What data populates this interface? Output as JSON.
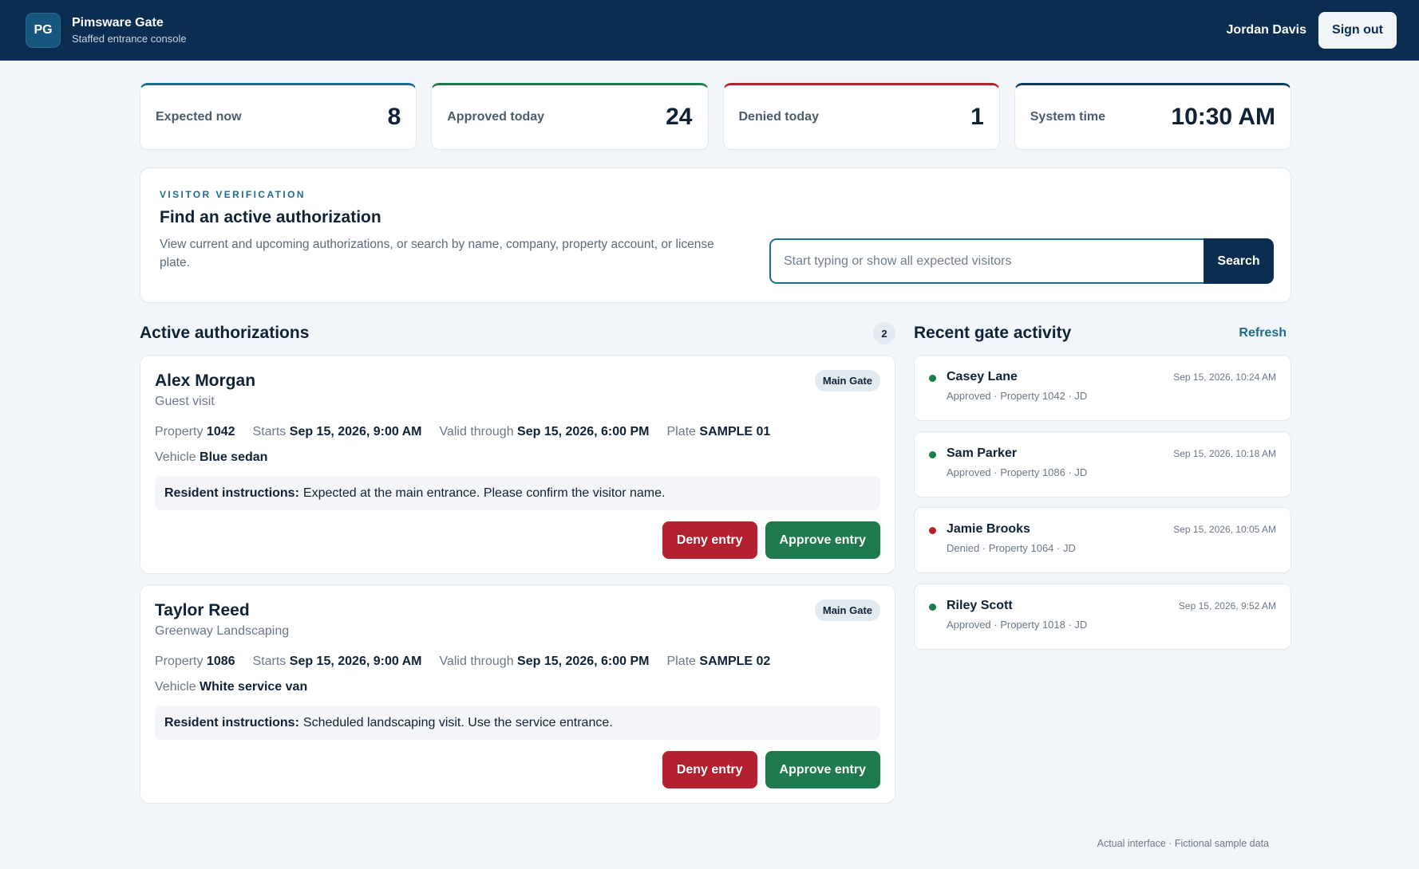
{
  "header": {
    "logo_text": "PG",
    "app_title": "Pimsware Gate",
    "app_subtitle": "Staffed entrance console",
    "user_name": "Jordan Davis",
    "signout_label": "Sign out"
  },
  "stats": [
    {
      "label": "Expected now",
      "value": "8"
    },
    {
      "label": "Approved today",
      "value": "24"
    },
    {
      "label": "Denied today",
      "value": "1"
    },
    {
      "label": "System time",
      "value": "10:30 AM"
    }
  ],
  "verification": {
    "eyebrow": "VISITOR VERIFICATION",
    "title": "Find an active authorization",
    "description": "View current and upcoming authorizations, or search by name, company, property account, or license plate.",
    "search_placeholder": "Start typing or show all expected visitors",
    "search_value": "",
    "search_button": "Search"
  },
  "authorizations": {
    "title": "Active authorizations",
    "count": "2",
    "labels": {
      "property": "Property",
      "starts": "Starts",
      "valid_through": "Valid through",
      "plate": "Plate",
      "vehicle": "Vehicle",
      "instructions": "Resident instructions:",
      "deny": "Deny entry",
      "approve": "Approve entry"
    },
    "items": [
      {
        "name": "Alex Morgan",
        "subtitle": "Guest visit",
        "gate": "Main Gate",
        "property": "1042",
        "starts": "Sep 15, 2026, 9:00 AM",
        "valid_through": "Sep 15, 2026, 6:00 PM",
        "plate": "SAMPLE 01",
        "vehicle": "Blue sedan",
        "instructions": "Expected at the main entrance. Please confirm the visitor name."
      },
      {
        "name": "Taylor Reed",
        "subtitle": "Greenway Landscaping",
        "gate": "Main Gate",
        "property": "1086",
        "starts": "Sep 15, 2026, 9:00 AM",
        "valid_through": "Sep 15, 2026, 6:00 PM",
        "plate": "SAMPLE 02",
        "vehicle": "White service van",
        "instructions": "Scheduled landscaping visit. Use the service entrance."
      }
    ]
  },
  "activity": {
    "title": "Recent gate activity",
    "refresh_label": "Refresh",
    "items": [
      {
        "name": "Casey Lane",
        "meta": "Approved · Property 1042 · JD",
        "time": "Sep 15, 2026, 10:24 AM",
        "status": "approved"
      },
      {
        "name": "Sam Parker",
        "meta": "Approved · Property 1086 · JD",
        "time": "Sep 15, 2026, 10:18 AM",
        "status": "approved"
      },
      {
        "name": "Jamie Brooks",
        "meta": "Denied · Property 1064 · JD",
        "time": "Sep 15, 2026, 10:05 AM",
        "status": "denied"
      },
      {
        "name": "Riley Scott",
        "meta": "Approved · Property 1018 · JD",
        "time": "Sep 15, 2026, 9:52 AM",
        "status": "approved"
      }
    ]
  },
  "footer_note": "Actual interface · Fictional sample data",
  "colors": {
    "header_bg": "#0b2d52",
    "accent": "#1e6b8f",
    "approve": "#1f7a4d",
    "deny": "#b3202e"
  }
}
